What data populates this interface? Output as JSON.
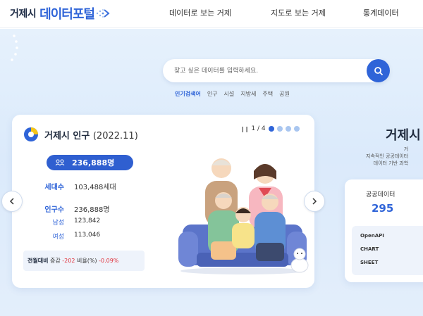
{
  "header": {
    "logo_city": "거제시",
    "logo_portal": "데이터포털",
    "nav": [
      "데이터로 보는 거제",
      "지도로 보는 거제",
      "통계데이터"
    ]
  },
  "search": {
    "placeholder": "찾고 싶은 데이터를 입력하세요.",
    "popular_label": "인기검색어",
    "keywords": [
      "인구",
      "시설",
      "지방세",
      "주택",
      "공원"
    ]
  },
  "card": {
    "title": "거제시 인구",
    "year": "(2022.11)",
    "pager": "1 / 4",
    "population_badge": "236,888명",
    "rows": [
      {
        "label": "세대수",
        "value": "103,488세대"
      },
      {
        "label": "인구수",
        "value": "236,888명"
      },
      {
        "label": "남성",
        "value": "123,842"
      },
      {
        "label": "여성",
        "value": "113,046"
      }
    ],
    "compare_label": "전월대비",
    "compare_text1": "증감",
    "compare_change": "-202",
    "compare_text2": "비율(%)",
    "compare_rate": "-0.09%"
  },
  "right": {
    "title": "거제시",
    "desc_line1": "거",
    "desc_line2": "지속적인 공공데이터",
    "desc_line3": "데이터 기반 과학",
    "stat_label": "공공데이터",
    "stat_value": "295",
    "stat_items": [
      "OpenAPI",
      "CHART",
      "SHEET"
    ]
  },
  "colors": {
    "brand": "#2f64d8",
    "accent_red": "#e0313b",
    "background": "#dbeafb"
  }
}
